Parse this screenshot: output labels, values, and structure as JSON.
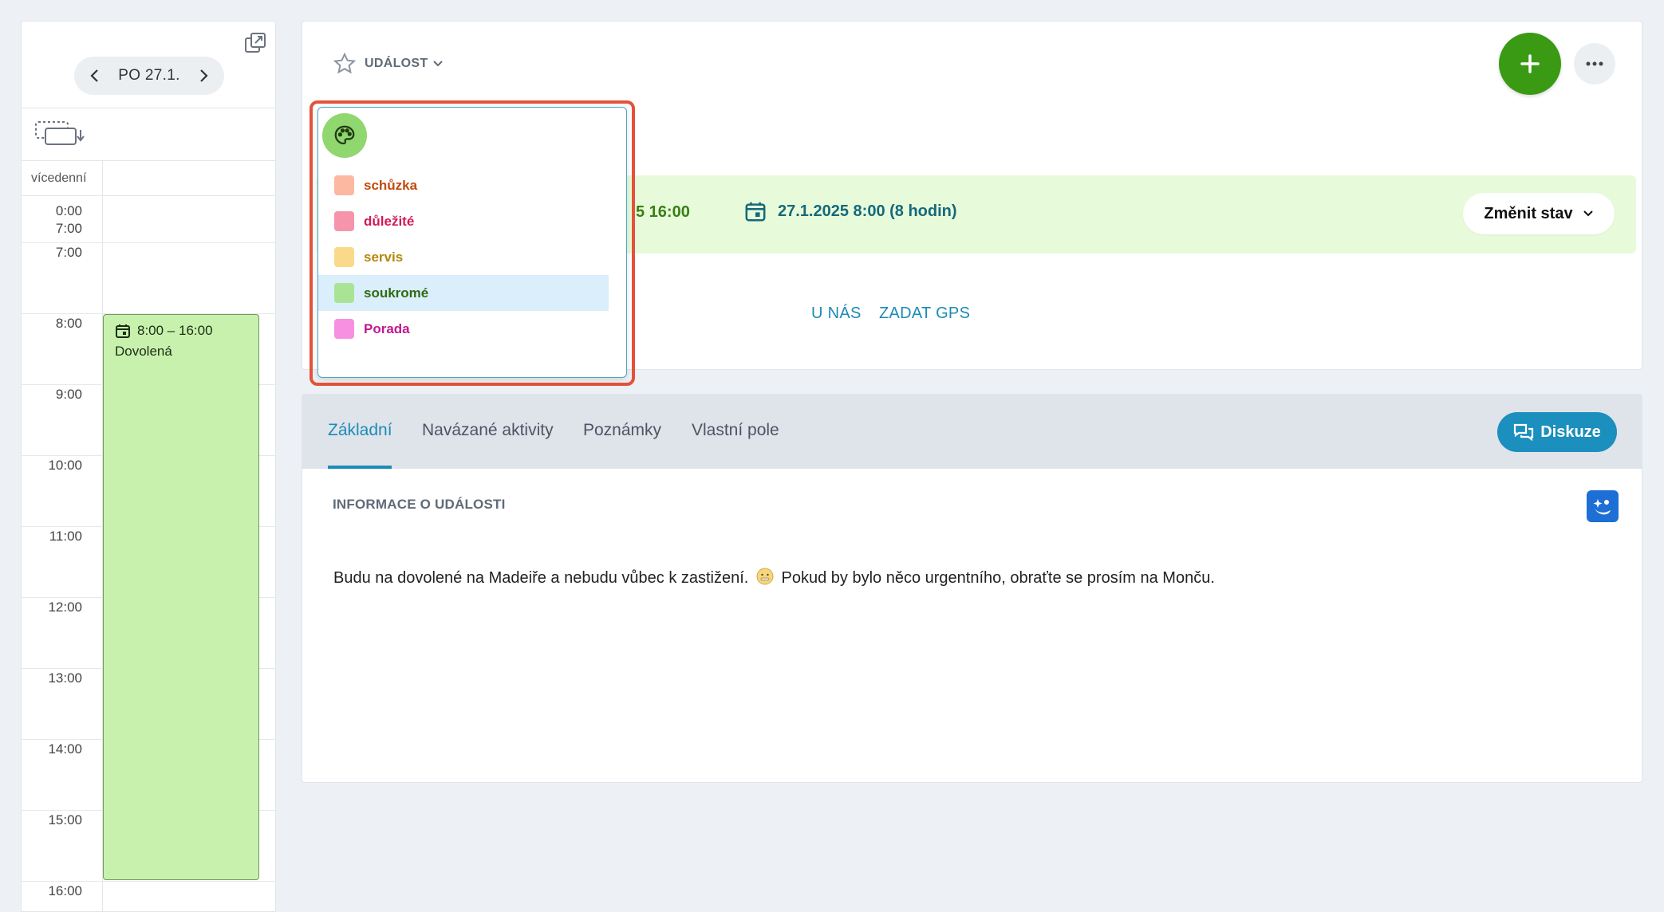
{
  "calendar": {
    "date_label": "PO 27.1.",
    "allday_label": "vícedenní",
    "time_range_top": "0:00",
    "time_range_bottom": "7:00",
    "hours": [
      "7:00",
      "8:00",
      "9:00",
      "10:00",
      "11:00",
      "12:00",
      "13:00",
      "14:00",
      "15:00",
      "16:00"
    ],
    "event": {
      "time": "8:00 – 16:00",
      "title": "Dovolená",
      "color": "#c8f1ae"
    }
  },
  "header": {
    "type_label": "UDÁLOST",
    "status_partial_text": "5 16:00",
    "date_text": "27.1.2025 8:00 (8 hodin)",
    "change_state_label": "Změnit stav",
    "location_links": [
      "U NÁS",
      "ZADAT GPS"
    ],
    "accent_green": "#3a9a14",
    "status_bg": "#e7fbdb"
  },
  "color_dropdown": {
    "options": [
      {
        "label": "schůzka",
        "swatch": "#fcb8a0",
        "text_color": "#c24a0f",
        "selected": false
      },
      {
        "label": "důležité",
        "swatch": "#f694ab",
        "text_color": "#d11a55",
        "selected": false
      },
      {
        "label": "servis",
        "swatch": "#fbd98a",
        "text_color": "#b8860b",
        "selected": false
      },
      {
        "label": "soukromé",
        "swatch": "#a8e493",
        "text_color": "#2f6b12",
        "selected": true
      },
      {
        "label": "Porada",
        "swatch": "#f790e0",
        "text_color": "#c2188d",
        "selected": false
      }
    ]
  },
  "tabs": [
    {
      "label": "Základní",
      "active": true
    },
    {
      "label": "Navázané aktivity",
      "active": false
    },
    {
      "label": "Poznámky",
      "active": false
    },
    {
      "label": "Vlastní pole",
      "active": false
    }
  ],
  "discussion_label": "Diskuze",
  "info": {
    "section_title": "INFORMACE O UDÁLOSTI",
    "description_before_emoji": "Budu na dovolené na Madeiře a nebudu vůbec k zastižení.",
    "description_after_emoji": "Pokud by bylo něco urgentního, obraťte se prosím na Monču."
  }
}
